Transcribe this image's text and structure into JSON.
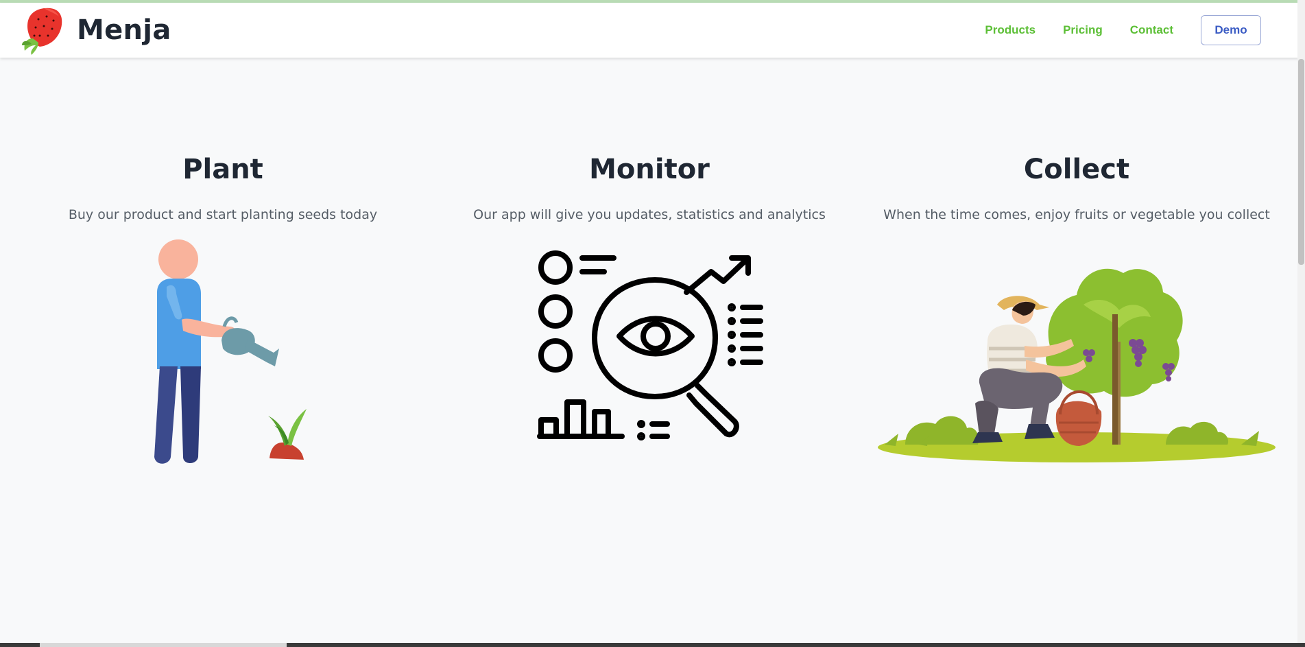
{
  "brand": {
    "name": "Menja",
    "logo_icon": "strawberry-icon"
  },
  "nav": {
    "links": [
      "Products",
      "Pricing",
      "Contact"
    ],
    "demo_label": "Demo",
    "link_color": "#5cbf36",
    "demo_color": "#3b5cc4"
  },
  "features": [
    {
      "title": "Plant",
      "text": "Buy our product and start planting seeds today",
      "illustration": "watering-person-illustration"
    },
    {
      "title": "Monitor",
      "text": "Our app will give you updates, statistics and analytics",
      "illustration": "analytics-magnifier-icon"
    },
    {
      "title": "Collect",
      "text": "When the time comes, enjoy fruits or vegetable you collect",
      "illustration": "harvesting-person-illustration"
    }
  ]
}
